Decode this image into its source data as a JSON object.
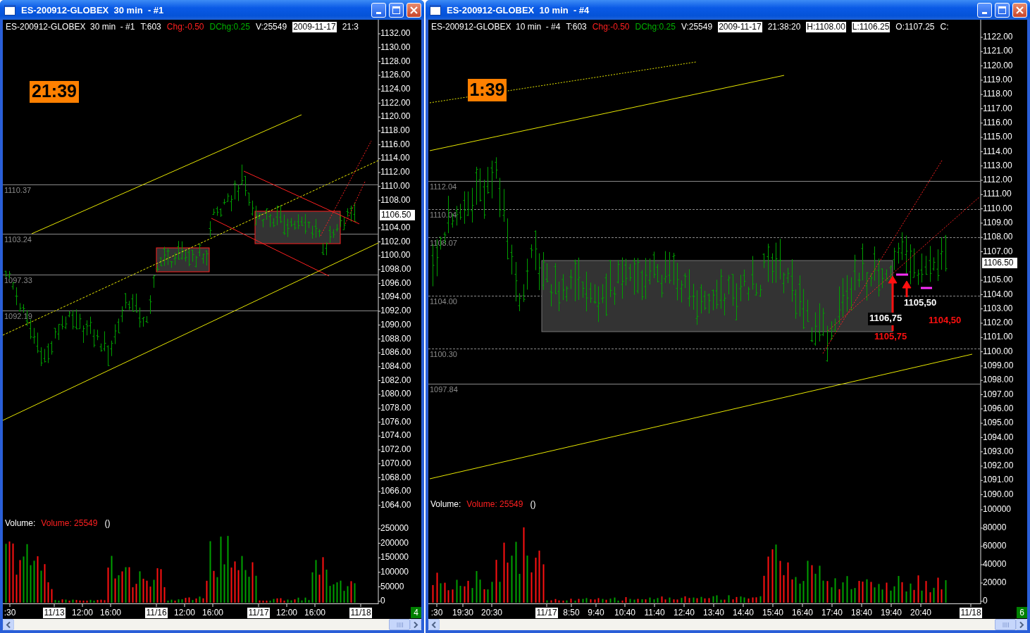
{
  "windows": [
    {
      "title": "ES-200912-GLOBEX  30 min  - #1",
      "info": [
        {
          "text": "ES-200912-GLOBEX  30 min  - #1",
          "kind": "plain"
        },
        {
          "text": "T:603",
          "kind": "plain"
        },
        {
          "text": "Chg:-0.50",
          "kind": "down"
        },
        {
          "text": "DChg:0.25",
          "kind": "up"
        },
        {
          "text": "V:25549",
          "kind": "plain"
        },
        {
          "text": "2009-11-17",
          "kind": "boxed"
        },
        {
          "text": "21:3",
          "kind": "plain"
        }
      ],
      "clock": "21:39",
      "price_axis": [
        "1132.00",
        "1130.00",
        "1128.00",
        "1126.00",
        "1124.00",
        "1122.00",
        "1120.00",
        "1118.00",
        "1116.00",
        "1114.00",
        "1112.00",
        "1110.00",
        "1108.00",
        "1104.00",
        "1102.00",
        "1100.00",
        "1098.00",
        "1096.00",
        "1094.00",
        "1092.00",
        "1090.00",
        "1088.00",
        "1086.00",
        "1084.00",
        "1082.00",
        "1080.00",
        "1078.00",
        "1076.00",
        "1074.00",
        "1072.00",
        "1070.00",
        "1068.00",
        "1066.00",
        "1064.00"
      ],
      "current_price": "1106.50",
      "levels": [
        {
          "label": "1110.37",
          "kind": "solid"
        },
        {
          "label": "1103.24",
          "kind": "solid"
        },
        {
          "label": "1097.33",
          "kind": "solid"
        },
        {
          "label": "1092.19",
          "kind": "solid"
        }
      ],
      "volume_title": "Volume:",
      "volume_value": "Volume: 25549",
      "volume_extra": "()",
      "volume_axis": [
        "250000",
        "200000",
        "150000",
        "100000",
        "50000",
        "0"
      ],
      "time_axis": [
        {
          "text": ":30",
          "boxed": false
        },
        {
          "text": "11/13",
          "boxed": true
        },
        {
          "text": "12:00",
          "boxed": false
        },
        {
          "text": "16:00",
          "boxed": false
        },
        {
          "text": "11/16",
          "boxed": true
        },
        {
          "text": "12:00",
          "boxed": false
        },
        {
          "text": "16:00",
          "boxed": false
        },
        {
          "text": "11/17",
          "boxed": true
        },
        {
          "text": "12:00",
          "boxed": false
        },
        {
          "text": "16:00",
          "boxed": false
        },
        {
          "text": "11/18",
          "boxed": true
        }
      ],
      "badge": "4"
    },
    {
      "title": "ES-200912-GLOBEX  10 min  - #4",
      "info": [
        {
          "text": "ES-200912-GLOBEX  10 min  - #4",
          "kind": "plain"
        },
        {
          "text": "T:603",
          "kind": "plain"
        },
        {
          "text": "Chg:-0.50",
          "kind": "down"
        },
        {
          "text": "DChg:0.25",
          "kind": "up"
        },
        {
          "text": "V:25549",
          "kind": "plain"
        },
        {
          "text": "2009-11-17",
          "kind": "boxed"
        },
        {
          "text": "21:38:20",
          "kind": "plain"
        },
        {
          "text": "H:1108.00",
          "kind": "boxed"
        },
        {
          "text": "L:1106.25",
          "kind": "boxed"
        },
        {
          "text": "O:1107.25",
          "kind": "plain"
        },
        {
          "text": "C:",
          "kind": "plain"
        }
      ],
      "clock": "1:39",
      "price_axis": [
        "1122.00",
        "1121.00",
        "1120.00",
        "1119.00",
        "1118.00",
        "1117.00",
        "1116.00",
        "1115.00",
        "1114.00",
        "1113.00",
        "1112.00",
        "1111.00",
        "1110.00",
        "1109.00",
        "1108.00",
        "1107.00",
        "1105.00",
        "1104.00",
        "1103.00",
        "1102.00",
        "1101.00",
        "1100.00",
        "1099.00",
        "1098.00",
        "1097.00",
        "1096.00",
        "1095.00",
        "1094.00",
        "1093.00",
        "1092.00",
        "1091.00",
        "1090.00"
      ],
      "current_price": "1106.50",
      "levels": [
        {
          "label": "1112.04",
          "kind": "solid"
        },
        {
          "label": "1110.04",
          "kind": "dashed"
        },
        {
          "label": "1108.07",
          "kind": "dashed"
        },
        {
          "label": "1104.00",
          "kind": "dashed"
        },
        {
          "label": "1100.30",
          "kind": "dashed"
        },
        {
          "label": "1097.84",
          "kind": "solid"
        }
      ],
      "volume_title": "Volume:",
      "volume_value": "Volume: 25549",
      "volume_extra": "()",
      "volume_axis": [
        "100000",
        "80000",
        "60000",
        "40000",
        "20000",
        "0"
      ],
      "time_axis": [
        {
          "text": ":30",
          "boxed": false
        },
        {
          "text": "19:30",
          "boxed": false
        },
        {
          "text": "20:30",
          "boxed": false
        },
        {
          "text": "11/17",
          "boxed": true
        },
        {
          "text": "8:50",
          "boxed": false
        },
        {
          "text": "9:40",
          "boxed": false
        },
        {
          "text": "10:40",
          "boxed": false
        },
        {
          "text": "11:40",
          "boxed": false
        },
        {
          "text": "12:40",
          "boxed": false
        },
        {
          "text": "13:40",
          "boxed": false
        },
        {
          "text": "14:40",
          "boxed": false
        },
        {
          "text": "15:40",
          "boxed": false
        },
        {
          "text": "16:40",
          "boxed": false
        },
        {
          "text": "17:40",
          "boxed": false
        },
        {
          "text": "18:40",
          "boxed": false
        },
        {
          "text": "19:40",
          "boxed": false
        },
        {
          "text": "20:40",
          "boxed": false
        },
        {
          "text": "11/18",
          "boxed": true
        }
      ],
      "badge": "6",
      "annotations": [
        {
          "text": "1105,50",
          "kind": "white"
        },
        {
          "text": "1106,75",
          "kind": "boxed"
        },
        {
          "text": "1104,50",
          "kind": "red"
        },
        {
          "text": "1105,75",
          "kind": "red"
        }
      ]
    }
  ]
}
